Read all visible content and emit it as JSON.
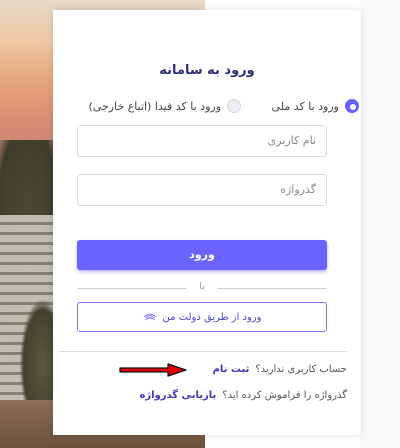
{
  "login": {
    "title": "ورود به سامانه",
    "radio_national": "ورود با کد ملی",
    "radio_fida": "ورود با کد فیدا (اتباع خارجی)",
    "username_placeholder": "نام کاربری",
    "password_placeholder": "گذرواژه",
    "login_button": "ورود",
    "or_text": "یا",
    "gov_login_button": "ورود از طریق دولت من",
    "no_account_text": "حساب کاربری ندارید؟",
    "register_link": "ثبت نام",
    "forgot_text": "گذرواژه را فراموش کرده اید؟",
    "recover_link": "بازیابی گذرواژه"
  },
  "colors": {
    "accent": "#6b63ff",
    "title": "#2c2e7a",
    "annotation_arrow": "#e00000"
  },
  "icons": {
    "gov": "fingerprint-icon",
    "annotation": "red-arrow-icon"
  }
}
